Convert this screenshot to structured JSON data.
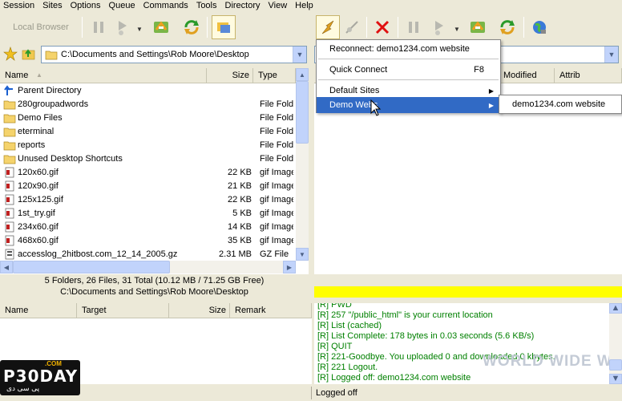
{
  "menu": [
    "Session",
    "Sites",
    "Options",
    "Queue",
    "Commands",
    "Tools",
    "Directory",
    "View",
    "Help"
  ],
  "toolbar": {
    "local_browser": "Local Browser"
  },
  "local": {
    "path": "C:\\Documents and Settings\\Rob Moore\\Desktop",
    "columns": {
      "name": "Name",
      "size": "Size",
      "type": "Type"
    },
    "files": [
      {
        "name": "Parent Directory",
        "size": "",
        "type": "",
        "icon": "up-arrow-icon"
      },
      {
        "name": "280groupadwords",
        "size": "",
        "type": "File Folder",
        "icon": "folder-icon"
      },
      {
        "name": "Demo Files",
        "size": "",
        "type": "File Folder",
        "icon": "folder-icon"
      },
      {
        "name": "eterminal",
        "size": "",
        "type": "File Folder",
        "icon": "folder-icon"
      },
      {
        "name": "reports",
        "size": "",
        "type": "File Folder",
        "icon": "folder-icon"
      },
      {
        "name": "Unused Desktop Shortcuts",
        "size": "",
        "type": "File Folder",
        "icon": "folder-icon"
      },
      {
        "name": "120x60.gif",
        "size": "22 KB",
        "type": "gif Image",
        "icon": "gif-file-icon"
      },
      {
        "name": "120x90.gif",
        "size": "21 KB",
        "type": "gif Image",
        "icon": "gif-file-icon"
      },
      {
        "name": "125x125.gif",
        "size": "22 KB",
        "type": "gif Image",
        "icon": "gif-file-icon"
      },
      {
        "name": "1st_try.gif",
        "size": "5 KB",
        "type": "gif Image",
        "icon": "gif-file-icon"
      },
      {
        "name": "234x60.gif",
        "size": "14 KB",
        "type": "gif Image",
        "icon": "gif-file-icon"
      },
      {
        "name": "468x60.gif",
        "size": "35 KB",
        "type": "gif Image",
        "icon": "gif-file-icon"
      },
      {
        "name": "accesslog_2hitbost.com_12_14_2005.gz",
        "size": "2.31 MB",
        "type": "GZ File",
        "icon": "gz-file-icon"
      }
    ],
    "status": "5 Folders, 26 Files, 31 Total (10.12 MB / 71.25 GB Free)",
    "status_path": "C:\\Documents and Settings\\Rob Moore\\Desktop"
  },
  "remote": {
    "columns": {
      "modified": "Modified",
      "attrib": "Attrib"
    }
  },
  "dropdown": {
    "items": [
      {
        "label": "Reconnect: demo1234.com website",
        "shortcut": ""
      },
      {
        "label": "Quick Connect",
        "shortcut": "F8"
      },
      {
        "label": "Default Sites",
        "shortcut": ""
      },
      {
        "label": "Demo Webs",
        "shortcut": ""
      }
    ],
    "submenu": "demo1234.com website"
  },
  "queue": {
    "columns": {
      "name": "Name",
      "target": "Target",
      "size": "Size",
      "remark": "Remark"
    }
  },
  "log": [
    {
      "text": "[R] PWD",
      "color": "#008000"
    },
    {
      "text": "[R] 257 \"/public_html\" is your current location",
      "color": "#008000"
    },
    {
      "text": "[R] List (cached)",
      "color": "#008000"
    },
    {
      "text": "[R] List Complete: 178 bytes in 0.03 seconds (5.6 KB/s)",
      "color": "#008000"
    },
    {
      "text": "[R] QUIT",
      "color": "#008000"
    },
    {
      "text": "[R] 221-Goodbye. You uploaded 0 and downloaded 0 kbytes.",
      "color": "#008000"
    },
    {
      "text": "[R] 221 Logout.",
      "color": "#008000"
    },
    {
      "text": "[R] Logged off: demo1234.com website",
      "color": "#008000"
    }
  ],
  "status_bar": "Logged off",
  "watermark": {
    "logo": "P30DAY",
    "logo_sub": ".COM",
    "logo_fa": "پی سی دی",
    "right": "WORLD WIDE WEB HOSTING"
  },
  "colors": {
    "selection": "#316ac5",
    "progress": "#ffff00",
    "log_text": "#008000"
  }
}
